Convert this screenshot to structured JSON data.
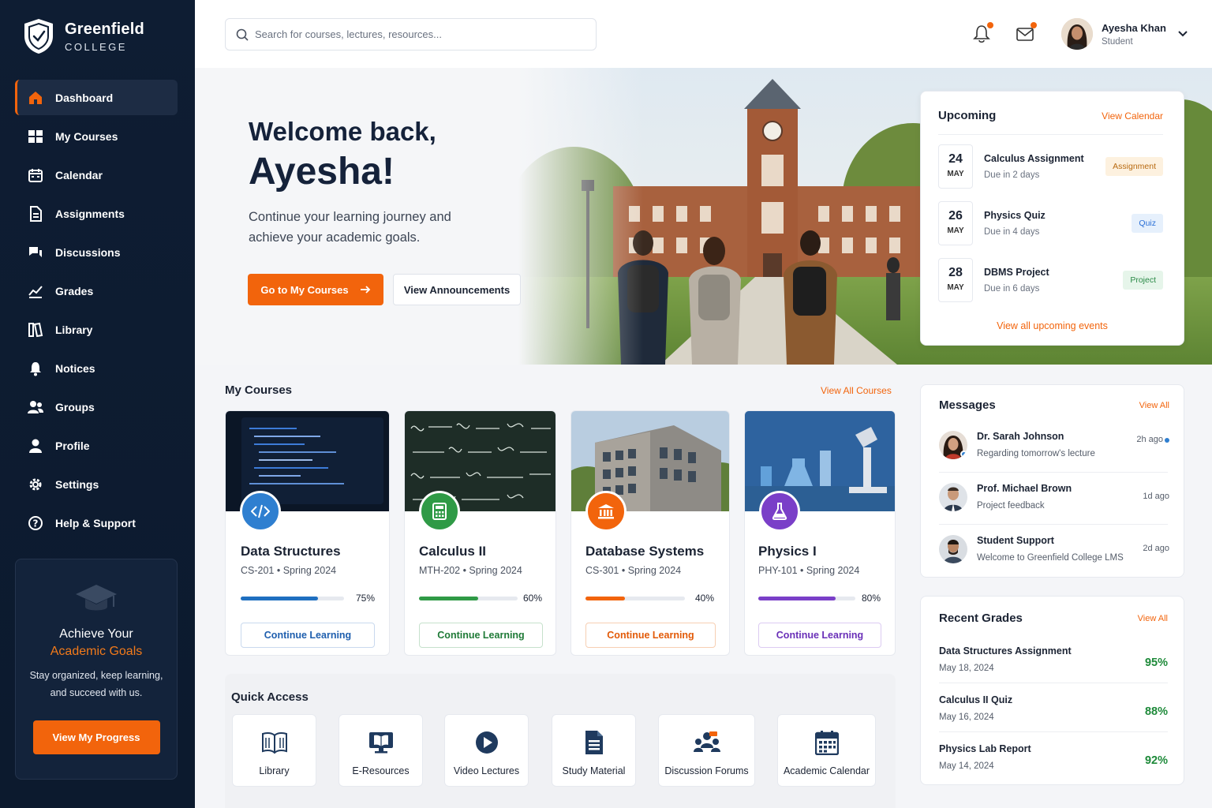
{
  "brand": {
    "name": "Greenfield",
    "sub": "COLLEGE"
  },
  "nav": [
    {
      "label": "Dashboard",
      "icon": "home-icon",
      "active": true
    },
    {
      "label": "My Courses",
      "icon": "courses-icon"
    },
    {
      "label": "Calendar",
      "icon": "calendar-icon"
    },
    {
      "label": "Assignments",
      "icon": "assignment-icon"
    },
    {
      "label": "Discussions",
      "icon": "discussion-icon"
    },
    {
      "label": "Grades",
      "icon": "grades-icon"
    },
    {
      "label": "Library",
      "icon": "library-icon"
    },
    {
      "label": "Notices",
      "icon": "bell-icon"
    },
    {
      "label": "Groups",
      "icon": "groups-icon"
    },
    {
      "label": "Profile",
      "icon": "profile-icon"
    },
    {
      "label": "Settings",
      "icon": "gear-icon"
    },
    {
      "label": "Help & Support",
      "icon": "help-icon"
    }
  ],
  "promo": {
    "title": "Achieve Your",
    "highlight": "Academic Goals",
    "text": "Stay organized, keep learning, and succeed with us.",
    "button": "View My Progress"
  },
  "search": {
    "placeholder": "Search for courses, lectures, resources..."
  },
  "user": {
    "name": "Ayesha Khan",
    "role": "Student"
  },
  "hero": {
    "greeting": "Welcome back,",
    "name": "Ayesha!",
    "subtitle": "Continue your learning journey and achieve your academic goals.",
    "primary_button": "Go to My Courses",
    "secondary_button": "View Announcements"
  },
  "upcoming": {
    "title": "Upcoming",
    "link": "View Calendar",
    "footer_link": "View all upcoming events",
    "items": [
      {
        "day": "24",
        "month": "MAY",
        "title": "Calculus Assignment",
        "due": "Due in 2 days",
        "tag": "Assignment",
        "tag_color": "#b86a10",
        "tag_bg": "#fdf1df"
      },
      {
        "day": "26",
        "month": "MAY",
        "title": "Physics Quiz",
        "due": "Due in 4 days",
        "tag": "Quiz",
        "tag_color": "#2a6fd6",
        "tag_bg": "#e6f0fc"
      },
      {
        "day": "28",
        "month": "MAY",
        "title": "DBMS Project",
        "due": "Due in 6 days",
        "tag": "Project",
        "tag_color": "#2b8a47",
        "tag_bg": "#e6f5ea"
      }
    ]
  },
  "courses": {
    "title": "My Courses",
    "link": "View All Courses",
    "items": [
      {
        "name": "Data Structures",
        "code": "CS-201 • Spring 2024",
        "progress": 75,
        "progress_label": "75%",
        "color": "#1f6fc0",
        "button": "Continue Learning",
        "icon": "code-icon"
      },
      {
        "name": "Calculus II",
        "code": "MTH-202 • Spring 2024",
        "progress": 60,
        "progress_label": "60%",
        "color": "#2f9a46",
        "button": "Continue Learning",
        "icon": "calculator-icon"
      },
      {
        "name": "Database Systems",
        "code": "CS-301 • Spring 2024",
        "progress": 40,
        "progress_label": "40%",
        "color": "#f2640c",
        "button": "Continue Learning",
        "icon": "institution-icon"
      },
      {
        "name": "Physics I",
        "code": "PHY-101 • Spring 2024",
        "progress": 80,
        "progress_label": "80%",
        "color": "#7a3fc8",
        "button": "Continue Learning",
        "icon": "flask-icon"
      }
    ]
  },
  "quick": {
    "title": "Quick Access",
    "items": [
      {
        "label": "Library",
        "icon": "library-book-icon"
      },
      {
        "label": "E-Resources",
        "icon": "monitor-book-icon"
      },
      {
        "label": "Video Lectures",
        "icon": "play-icon"
      },
      {
        "label": "Study Material",
        "icon": "document-icon"
      },
      {
        "label": "Discussion Forums",
        "icon": "forum-icon"
      },
      {
        "label": "Academic Calendar",
        "icon": "calendar-grid-icon"
      }
    ]
  },
  "messages": {
    "title": "Messages",
    "link": "View All",
    "items": [
      {
        "name": "Dr. Sarah Johnson",
        "text": "Regarding tomorrow's lecture",
        "time": "2h ago",
        "unread": true
      },
      {
        "name": "Prof. Michael Brown",
        "text": "Project feedback",
        "time": "1d ago"
      },
      {
        "name": "Student Support",
        "text": "Welcome to Greenfield College LMS",
        "time": "2d ago"
      }
    ]
  },
  "grades": {
    "title": "Recent Grades",
    "link": "View All",
    "items": [
      {
        "name": "Data Structures Assignment",
        "date": "May 18, 2024",
        "score": "95%"
      },
      {
        "name": "Calculus II Quiz",
        "date": "May 16, 2024",
        "score": "88%"
      },
      {
        "name": "Physics Lab Report",
        "date": "May 14, 2024",
        "score": "92%"
      }
    ]
  },
  "colors": {
    "accent": "#f2640c",
    "sidebar": "#0e1d33",
    "grade": "#1e8a3a"
  }
}
